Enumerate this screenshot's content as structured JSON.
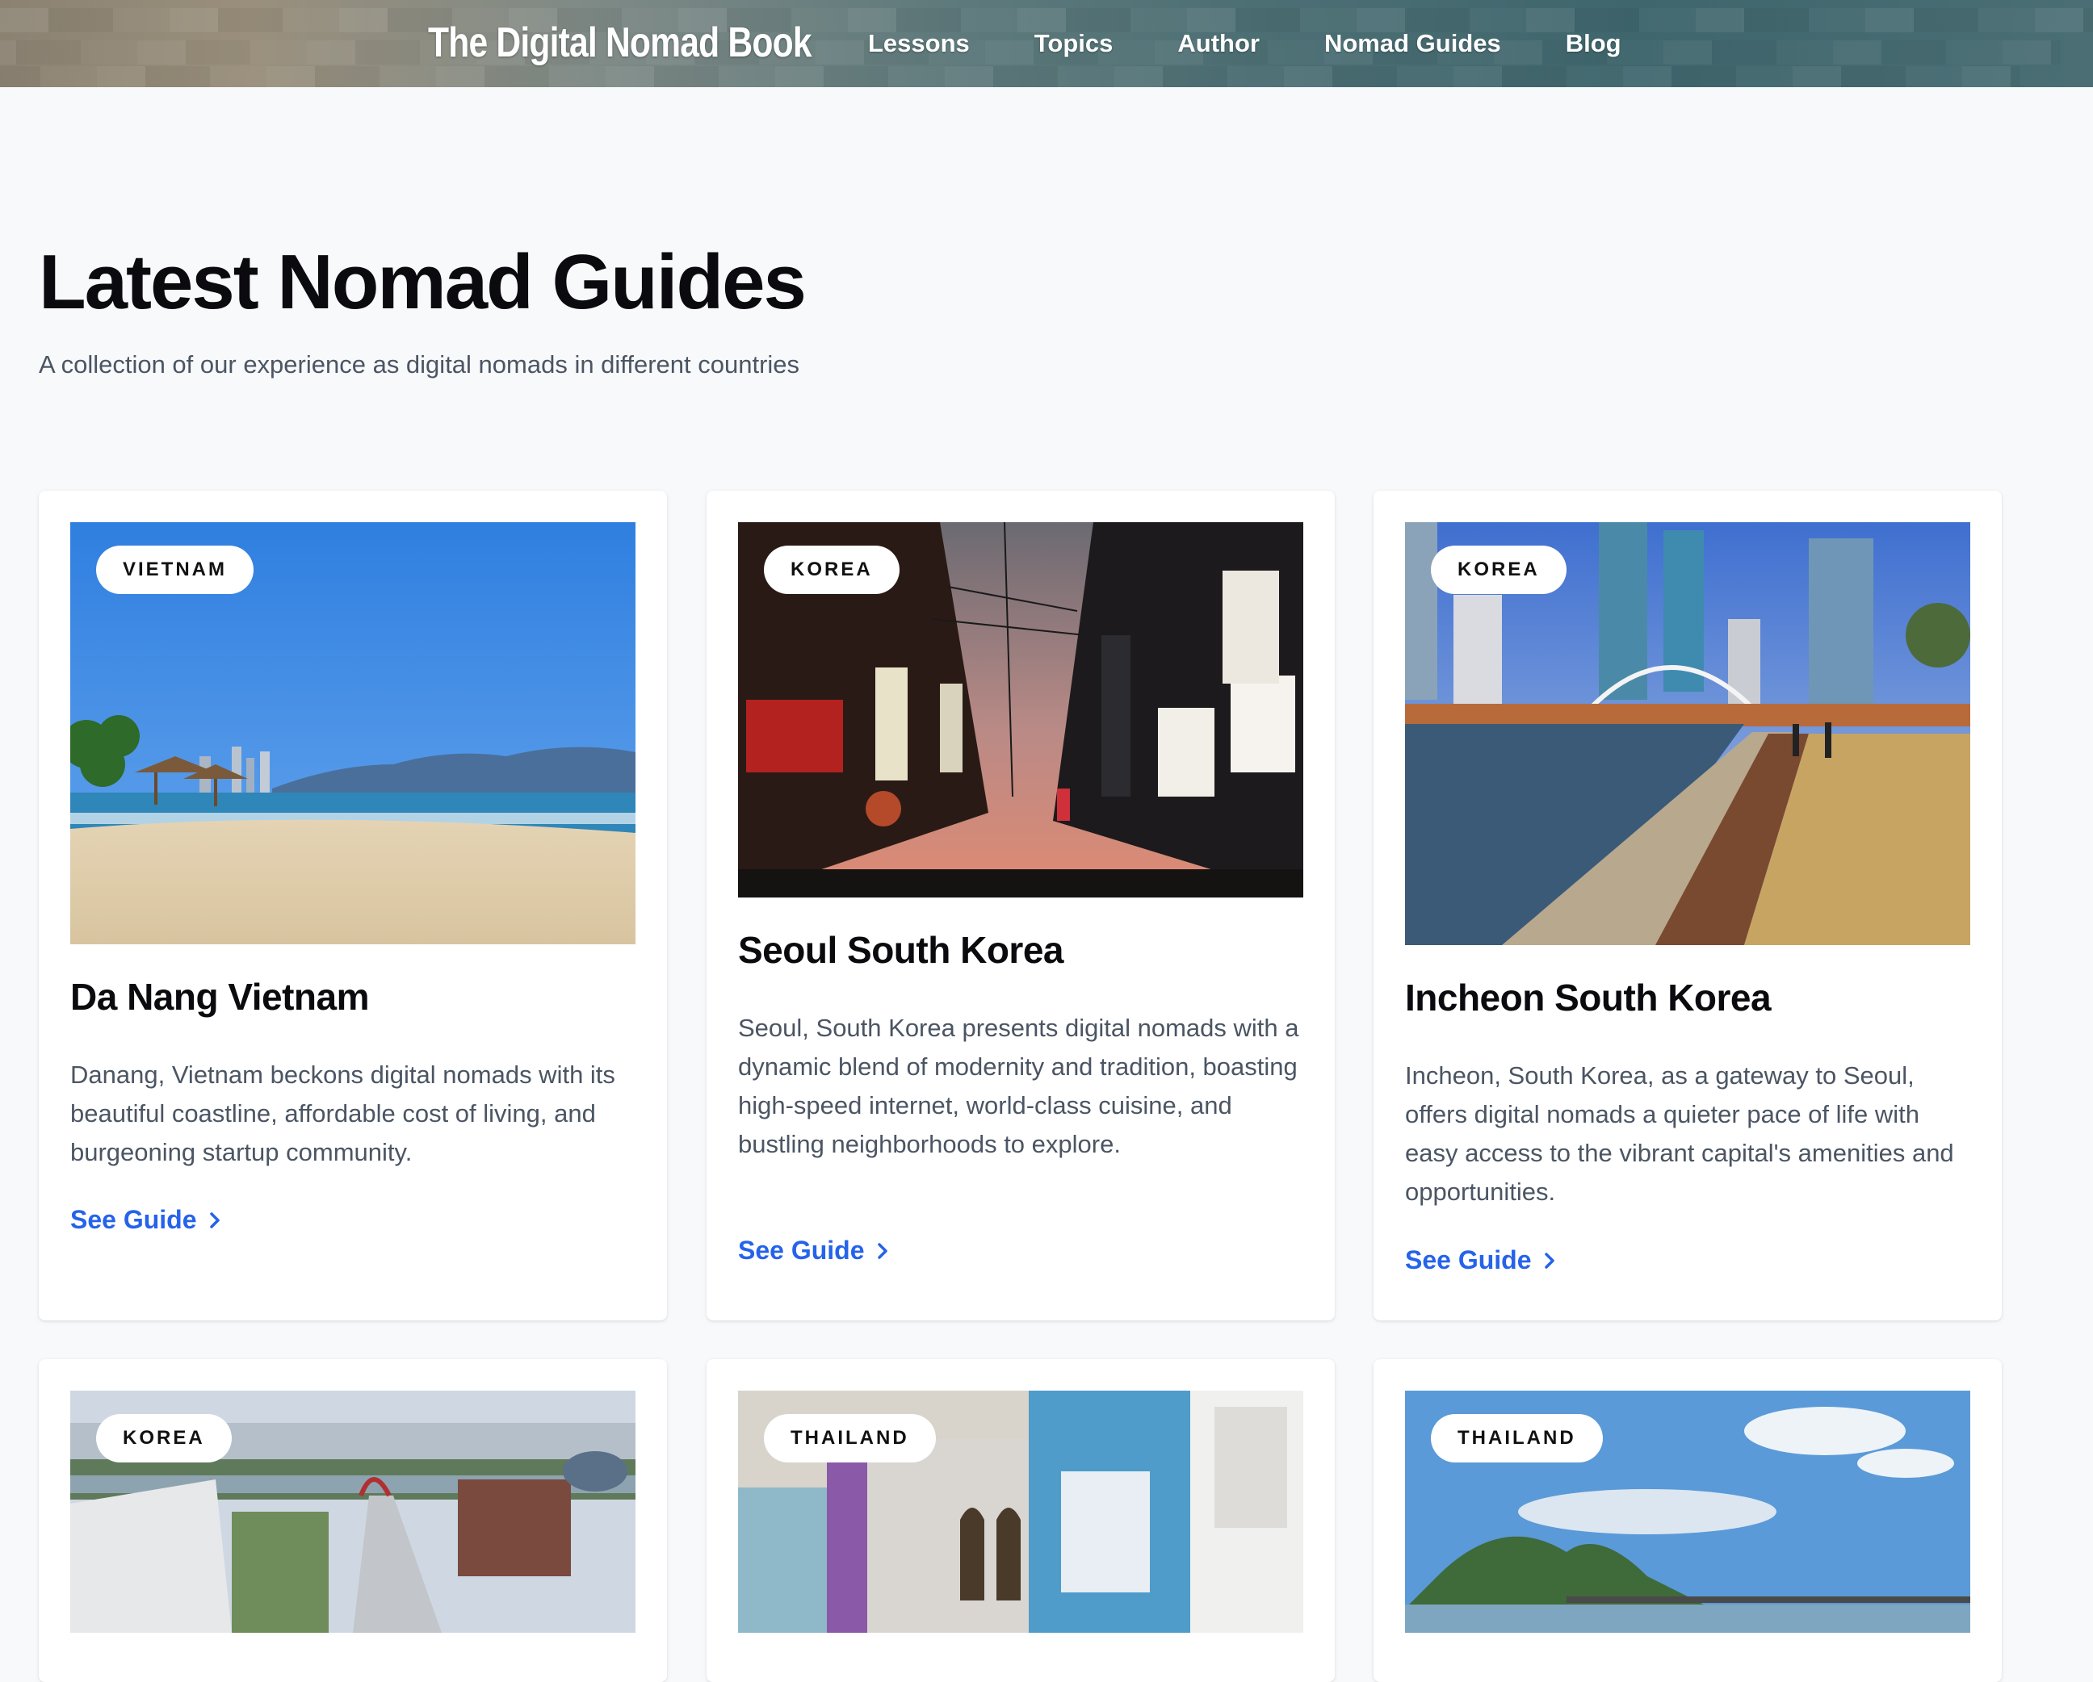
{
  "header": {
    "brand": "The Digital Nomad Book",
    "nav": [
      "Lessons",
      "Topics",
      "Author",
      "Nomad Guides",
      "Blog"
    ]
  },
  "intro": {
    "title": "Latest Nomad Guides",
    "subtitle": "A collection of our experience as digital nomads in different countries"
  },
  "cards": [
    {
      "tag": "VIETNAM",
      "title": "Da Nang Vietnam",
      "description": "Danang, Vietnam beckons digital nomads with its beautiful coastline, affordable cost of living, and burgeoning startup community.",
      "link": "See Guide"
    },
    {
      "tag": "KOREA",
      "title": "Seoul South Korea",
      "description": "Seoul, South Korea presents digital nomads with a dynamic blend of modernity and tradition, boasting high-speed internet, world-class cuisine, and bustling neighborhoods to explore.",
      "link": "See Guide"
    },
    {
      "tag": "KOREA",
      "title": "Incheon South Korea",
      "description": "Incheon, South Korea, as a gateway to Seoul, offers digital nomads a quieter pace of life with easy access to the vibrant capital's amenities and opportunities.",
      "link": "See Guide"
    },
    {
      "tag": "KOREA"
    },
    {
      "tag": "THAILAND"
    },
    {
      "tag": "THAILAND"
    }
  ],
  "colors": {
    "page_background": "#f8f9fb",
    "link": "#2563eb",
    "body_text": "#4b5563",
    "heading": "#0b0b0f"
  },
  "icons": {
    "see_guide": "chevron-right-icon"
  }
}
